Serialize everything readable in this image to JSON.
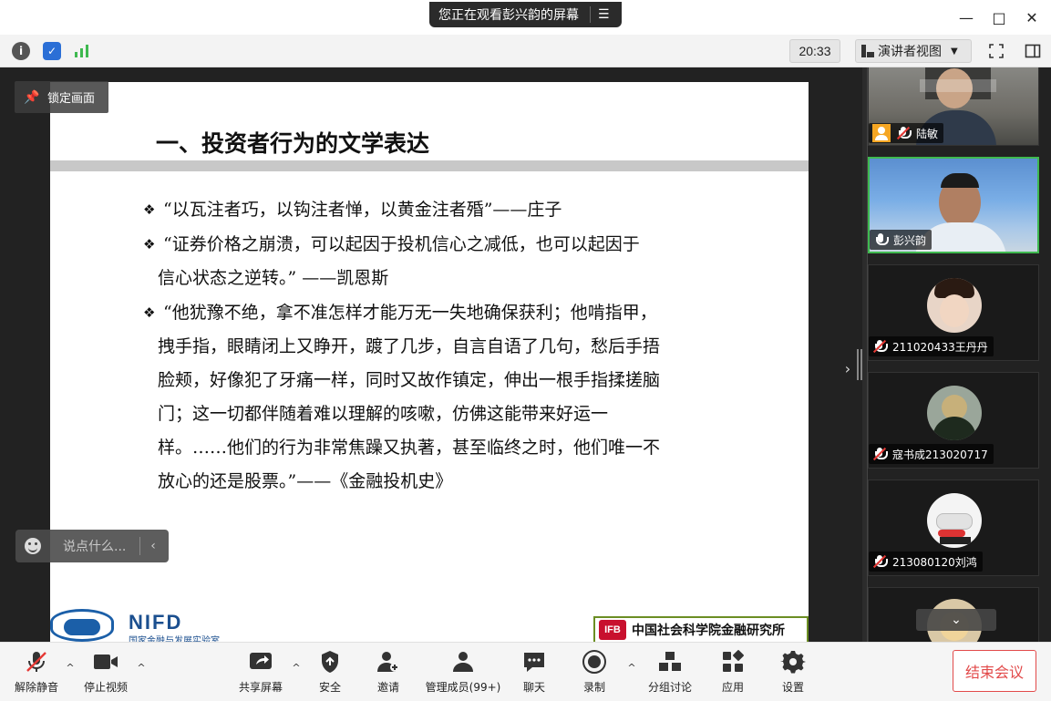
{
  "titlebar": {
    "share_banner": "您正在观看彭兴韵的屏幕",
    "minimize": "—",
    "maximize": "□",
    "close": "✕"
  },
  "infobar": {
    "clock": "20:33",
    "view_mode": "演讲者视图",
    "icon_colors": {
      "info": "#555555",
      "shield": "#2b6fd6",
      "signal": "#3fb950"
    }
  },
  "slide": {
    "title": "一、投资者行为的文学表达",
    "bullets": [
      {
        "mark": "❖",
        "lines": [
          "“以瓦注者巧，以钩注者惮，以黄金注者殙”——庄子"
        ]
      },
      {
        "mark": "❖",
        "lines": [
          "“证券价格之崩溃，可以起因于投机信心之减低，也可以起因于",
          "信心状态之逆转。” ——凯恩斯"
        ]
      },
      {
        "mark": "❖",
        "lines": [
          "“他犹豫不绝，拿不准怎样才能万无一失地确保获利；他啃指甲，",
          "拽手指，眼睛闭上又睁开，踱了几步，自言自语了几句，愁后手捂",
          "脸颊，好像犯了牙痛一样，同时又故作镇定，伸出一根手指揉搓脑",
          "门；这一切都伴随着难以理解的咳嗽，仿佛这能带来好运一",
          "样。……他们的行为非常焦躁又执著，甚至临终之时，他们唯一不",
          "放心的还是股票。”——《金融投机史》"
        ]
      }
    ],
    "footer": {
      "nifd": "NIFD",
      "nifd_sub": "国家金融与发展实验室",
      "ifb_badge": "IFB",
      "ifb_name": "中国社会科学院金融研究所"
    }
  },
  "overlay": {
    "pin_label": "锁定画面",
    "chat_placeholder": "说点什么...",
    "chat_collapse": "‹",
    "side_toggle": "›"
  },
  "participants": [
    {
      "name": "陆敏",
      "muted": true,
      "host": true
    },
    {
      "name": "彭兴韵",
      "muted": false,
      "host": false,
      "active": true
    },
    {
      "name": "211020433王丹丹",
      "muted": true,
      "host": false
    },
    {
      "name": "寇书成213020717",
      "muted": true,
      "host": false
    },
    {
      "name": "213080120刘鸿",
      "muted": true,
      "host": false
    }
  ],
  "panel": {
    "scroll_down": "⌄"
  },
  "toolbar": {
    "unmute": "解除静音",
    "stop_video": "停止视频",
    "share_screen": "共享屏幕",
    "security": "安全",
    "invite": "邀请",
    "manage_members": "管理成员(99+)",
    "chat": "聊天",
    "record": "录制",
    "breakout": "分组讨论",
    "apps": "应用",
    "settings": "设置",
    "end_meeting": "结束会议",
    "caret": "^"
  },
  "colors": {
    "active_speaker": "#3fb950",
    "end_meeting": "#e24a4a",
    "mute_slash": "#e53935",
    "host_badge": "#f5a623"
  }
}
